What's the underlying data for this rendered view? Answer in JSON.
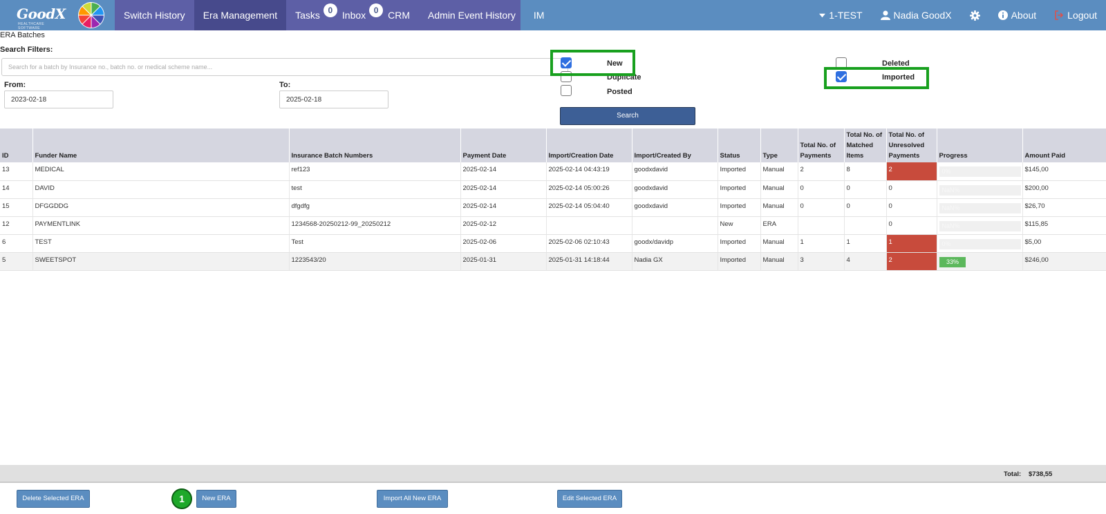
{
  "header": {
    "logo_text": "GoodX",
    "logo_sub": "HEALTHCARE SOFTWARE",
    "nav": [
      {
        "label": "Switch History"
      },
      {
        "label": "Era Management"
      },
      {
        "label": "Tasks",
        "badge": "0"
      },
      {
        "label": "Inbox",
        "badge": "0"
      },
      {
        "label": "CRM"
      },
      {
        "label": "Admin Event History"
      },
      {
        "label": "IM"
      }
    ],
    "practice": "1-TEST",
    "user": "Nadia GoodX",
    "about": "About",
    "logout": "Logout"
  },
  "page": {
    "title": "ERA Batches",
    "filters_label": "Search Filters:",
    "search_placeholder": "Search for a batch by Insurance no., batch no. or medical scheme name...",
    "from_label": "From:",
    "from_value": "2023-02-18",
    "to_label": "To:",
    "to_value": "2025-02-18",
    "checkboxes": {
      "new": {
        "label": "New",
        "checked": true
      },
      "duplicate": {
        "label": "Duplicate",
        "checked": false
      },
      "posted": {
        "label": "Posted",
        "checked": false
      },
      "deleted": {
        "label": "Deleted",
        "checked": false
      },
      "imported": {
        "label": "Imported",
        "checked": true
      }
    },
    "search_button": "Search"
  },
  "table": {
    "columns": [
      "ID",
      "Funder Name",
      "Insurance Batch Numbers",
      "Payment Date",
      "Import/Creation Date",
      "Import/Created By",
      "Status",
      "Type",
      "Total No. of Payments",
      "Total No. of Matched Items",
      "Total No. of Unresolved Payments",
      "Progress",
      "Amount Paid"
    ],
    "rows": [
      {
        "id": "13",
        "funder": "MEDICAL",
        "batch": "ref123",
        "payment_date": "2025-02-14",
        "import_date": "2025-02-14 04:43:19",
        "created_by": "goodxdavid",
        "status": "Imported",
        "type": "Manual",
        "payments": "2",
        "matched": "8",
        "unresolved": "2",
        "unresolved_flag": true,
        "progress": "0%",
        "progress_value": 0,
        "amount": "$145,00"
      },
      {
        "id": "14",
        "funder": "DAVID",
        "batch": "test",
        "payment_date": "2025-02-14",
        "import_date": "2025-02-14 05:00:26",
        "created_by": "goodxdavid",
        "status": "Imported",
        "type": "Manual",
        "payments": "0",
        "matched": "0",
        "unresolved": "0",
        "unresolved_flag": false,
        "progress": "NaN%",
        "progress_value": 0,
        "amount": "$200,00"
      },
      {
        "id": "15",
        "funder": "DFGGDDG",
        "batch": "dfgdfg",
        "payment_date": "2025-02-14",
        "import_date": "2025-02-14 05:04:40",
        "created_by": "goodxdavid",
        "status": "Imported",
        "type": "Manual",
        "payments": "0",
        "matched": "0",
        "unresolved": "0",
        "unresolved_flag": false,
        "progress": "NaN%",
        "progress_value": 0,
        "amount": "$26,70"
      },
      {
        "id": "12",
        "funder": "PAYMENTLINK",
        "batch": "1234568-20250212-99_20250212",
        "payment_date": "2025-02-12",
        "import_date": "",
        "created_by": "",
        "status": "New",
        "type": "ERA",
        "payments": "",
        "matched": "",
        "unresolved": "0",
        "unresolved_flag": false,
        "progress": "NaN%",
        "progress_value": 0,
        "amount": "$115,85"
      },
      {
        "id": "6",
        "funder": "TEST",
        "batch": "Test",
        "payment_date": "2025-02-06",
        "import_date": "2025-02-06 02:10:43",
        "created_by": "goodx/davidp",
        "status": "Imported",
        "type": "Manual",
        "payments": "1",
        "matched": "1",
        "unresolved": "1",
        "unresolved_flag": true,
        "progress": "0%",
        "progress_value": 0,
        "amount": "$5,00"
      },
      {
        "id": "5",
        "funder": "SWEETSPOT",
        "batch": "1223543/20",
        "payment_date": "2025-01-31",
        "import_date": "2025-01-31 14:18:44",
        "created_by": "Nadia GX",
        "status": "Imported",
        "type": "Manual",
        "payments": "3",
        "matched": "4",
        "unresolved": "2",
        "unresolved_flag": true,
        "progress": "33%",
        "progress_value": 33,
        "amount": "$246,00"
      }
    ]
  },
  "footer": {
    "total_label": "Total:",
    "total_value": "$738,55",
    "delete_button": "Delete Selected ERA",
    "step_number": "1",
    "new_button": "New ERA",
    "import_button": "Import All New ERA",
    "edit_button": "Edit Selected ERA"
  },
  "colors": {
    "topbar": "#5b8dc0",
    "navmenu": "#5d5fa6",
    "highlight": "#18a01e",
    "unresolved": "#c84b3c",
    "progress": "#5cb85c"
  }
}
